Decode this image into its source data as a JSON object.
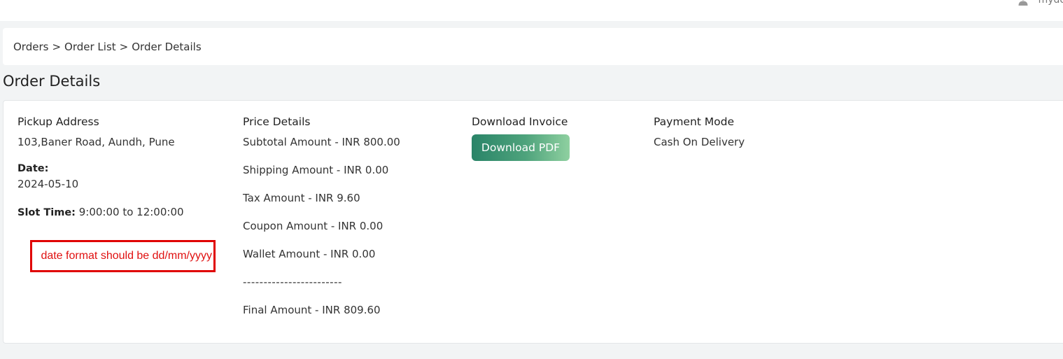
{
  "header": {
    "user_name": "mydo"
  },
  "breadcrumb": {
    "items": [
      "Orders",
      "Order List",
      "Order Details"
    ],
    "separator": ">"
  },
  "page": {
    "title": "Order Details"
  },
  "pickup": {
    "heading": "Pickup Address",
    "address": "103,Baner Road, Aundh, Pune",
    "date_label": "Date:",
    "date_value": "2024-05-10",
    "slot_label": "Slot Time:",
    "slot_value": "9:00:00 to 12:00:00"
  },
  "annotation": {
    "text": "date format should be dd/mm/yyyy",
    "color": "#e00000"
  },
  "price": {
    "heading": "Price Details",
    "subtotal": "Subtotal Amount - INR 800.00",
    "shipping": "Shipping Amount - INR 0.00",
    "tax": "Tax Amount - INR 9.60",
    "coupon": "Coupon Amount - INR 0.00",
    "wallet": "Wallet Amount - INR 0.00",
    "divider": "------------------------",
    "final": "Final Amount - INR 809.60"
  },
  "invoice": {
    "heading": "Download Invoice",
    "button_label": "Download PDF",
    "button_color_start": "#2a8468",
    "button_color_end": "#8fd0a0"
  },
  "payment": {
    "heading": "Payment Mode",
    "value": "Cash On Delivery"
  }
}
